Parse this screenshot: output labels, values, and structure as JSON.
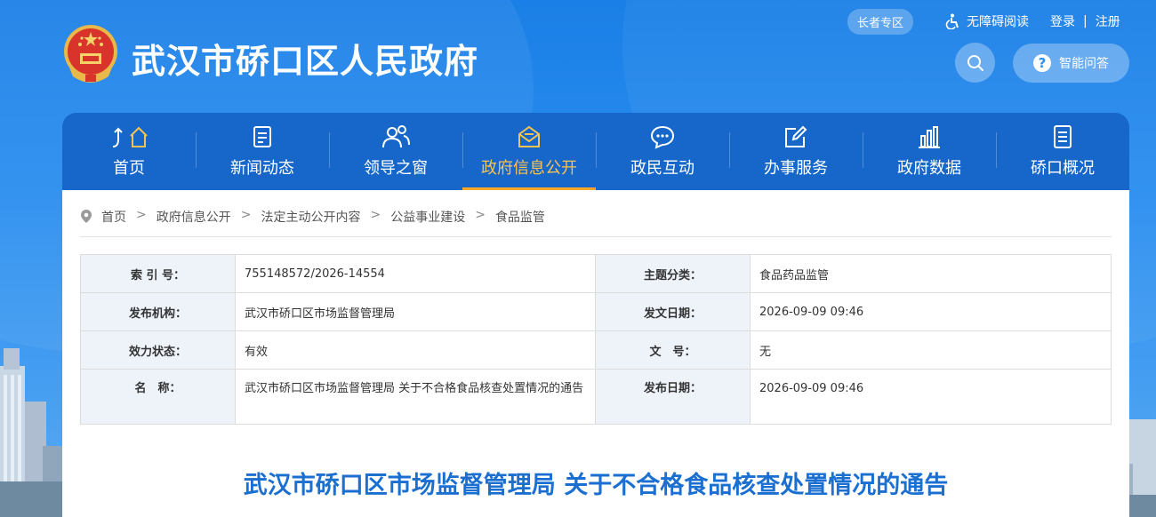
{
  "header": {
    "site_title": "武汉市硚口区人民政府",
    "elder_zone": "长者专区",
    "accessibility": "无障碍阅读",
    "login": "登录",
    "separator": "|",
    "register": "注册",
    "ai_qa": "智能问答",
    "ai_qa_icon_text": "?"
  },
  "nav": [
    {
      "label": "首页",
      "icon": "home-icon"
    },
    {
      "label": "新闻动态",
      "icon": "news-icon"
    },
    {
      "label": "领导之窗",
      "icon": "leaders-icon"
    },
    {
      "label": "政府信息公开",
      "icon": "mail-icon",
      "active": true
    },
    {
      "label": "政民互动",
      "icon": "chat-icon"
    },
    {
      "label": "办事服务",
      "icon": "edit-icon"
    },
    {
      "label": "政府数据",
      "icon": "bar-chart-icon"
    },
    {
      "label": "硚口概况",
      "icon": "document-icon"
    }
  ],
  "breadcrumb": {
    "items": [
      "首页",
      "政府信息公开",
      "法定主动公开内容",
      "公益事业建设",
      "食品监管"
    ],
    "separator": ">"
  },
  "meta": {
    "index_no_label": "索 引 号：",
    "index_no": "755148572/2026-14554",
    "category_label": "主题分类：",
    "category": "食品药品监管",
    "publisher_label": "发布机构：",
    "publisher": "武汉市硚口区市场监督管理局",
    "issue_date_label": "发文日期：",
    "issue_date": "2026-09-09 09:46",
    "status_label": "效力状态：",
    "status": "有效",
    "doc_no_label": "文　号：",
    "doc_no": "无",
    "name_label": "名　称：",
    "name": "武汉市硚口区市场监督管理局 关于不合格食品核查处置情况的通告",
    "publish_date_label": "发布日期：",
    "publish_date": "2026-09-09 09:46"
  },
  "document_title": "武汉市硚口区市场监督管理局 关于不合格食品核查处置情况的通告",
  "colors": {
    "nav_bg": "#1667c9",
    "active_nav": "#f9c353",
    "title_blue": "#1a6fd1",
    "key_cell_bg": "#eef3fa"
  }
}
